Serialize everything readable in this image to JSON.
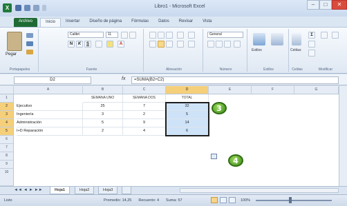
{
  "window": {
    "title": "Libro1 - Microsoft Excel",
    "app_icon": "X"
  },
  "window_controls": {
    "minimize": "–",
    "maximize": "□",
    "close": "✕"
  },
  "tabs": [
    "Archivo",
    "Inicio",
    "Insertar",
    "Diseño de página",
    "Fórmulas",
    "Datos",
    "Revisar",
    "Vista"
  ],
  "ribbon": {
    "paste_label": "Pegar",
    "font_name": "Calibri",
    "font_size": "11",
    "number_format": "General",
    "group_labels": [
      "Portapapeles",
      "Fuente",
      "Alineación",
      "Número",
      "Estilos",
      "Celdas",
      "Modificar"
    ],
    "bold": "N",
    "italic": "K",
    "underline": "S",
    "styles_label": "Estilos",
    "cells_label": "Celdas"
  },
  "formula_bar": {
    "name_box": "D2",
    "fx": "fx",
    "formula": "=SUMA(B2+C2)"
  },
  "columns": [
    "A",
    "B",
    "C",
    "D",
    "E",
    "F",
    "G"
  ],
  "rows": [
    "1",
    "2",
    "3",
    "4",
    "5",
    "6",
    "7",
    "8",
    "9",
    "10"
  ],
  "headers": {
    "b": "SEMANA UNO",
    "c": "SEMANA DOS",
    "d": "TOTAL"
  },
  "data_rows": [
    {
      "a": "Ejecutivo",
      "b": "25",
      "c": "7",
      "d": "32"
    },
    {
      "a": "Ingeniería",
      "b": "3",
      "c": "2",
      "d": "5"
    },
    {
      "a": "Administración",
      "b": "5",
      "c": "9",
      "d": "14"
    },
    {
      "a": "I+D Reparación",
      "b": "2",
      "c": "4",
      "d": "6"
    }
  ],
  "markers": {
    "m3": "3",
    "m4": "4"
  },
  "sheets": [
    "Hoja1",
    "Hoja2",
    "Hoja3"
  ],
  "sheet_nav": [
    "◄◄",
    "◄",
    "►",
    "►►"
  ],
  "status": {
    "ready": "Listo",
    "average": "Promedio: 14,25",
    "count": "Recuento: 4",
    "sum": "Suma: 57",
    "zoom": "100%"
  },
  "colors": {
    "file_tab": "#1f6b34",
    "selection_fill": "#cfe3f8",
    "marker_green": "#3f8a1b",
    "header_selected": "#f5cf7a"
  }
}
